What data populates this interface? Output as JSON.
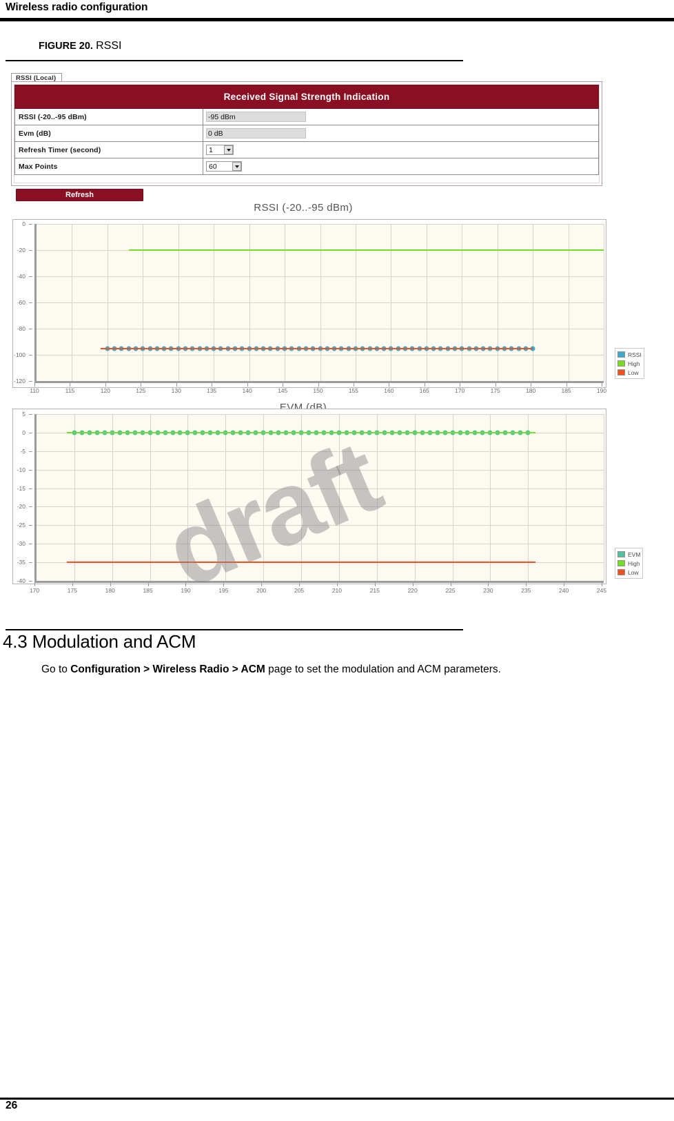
{
  "header": {
    "running_title": "Wireless radio configuration"
  },
  "figure": {
    "number": "FIGURE 20.",
    "title": "RSSI"
  },
  "ui_panel": {
    "tab_label": "RSSI (Local)",
    "panel_title": "Received Signal Strength Indication",
    "rows": [
      {
        "label": "RSSI (-20..-95 dBm)",
        "value": "-95 dBm",
        "control": "readonly"
      },
      {
        "label": "Evm (dB)",
        "value": "0 dB",
        "control": "readonly"
      },
      {
        "label": "Refresh Timer (second)",
        "value": "1",
        "control": "select"
      },
      {
        "label": "Max Points",
        "value": "60",
        "control": "select-wide"
      }
    ],
    "refresh_button": "Refresh",
    "title_bg": "#8a0f22"
  },
  "chart_data": [
    {
      "id": "rssi",
      "type": "line",
      "title": "RSSI (-20..-95 dBm)",
      "xlabel": "",
      "ylabel": "",
      "xlim": [
        110,
        190
      ],
      "ylim": [
        -120,
        0
      ],
      "xticks": [
        110,
        115,
        120,
        125,
        130,
        135,
        140,
        145,
        150,
        155,
        160,
        165,
        170,
        175,
        180,
        185,
        190
      ],
      "yticks": [
        0,
        -20,
        -40,
        -60,
        -80,
        -100,
        -120
      ],
      "grid": true,
      "legend_position": "right",
      "series": [
        {
          "name": "RSSI",
          "color": "#3fa9c9",
          "marker": "circle",
          "x": [
            120,
            121,
            122,
            123,
            124,
            125,
            126,
            127,
            128,
            129,
            130,
            131,
            132,
            133,
            134,
            135,
            136,
            137,
            138,
            139,
            140,
            141,
            142,
            143,
            144,
            145,
            146,
            147,
            148,
            149,
            150,
            151,
            152,
            153,
            154,
            155,
            156,
            157,
            158,
            159,
            160,
            161,
            162,
            163,
            164,
            165,
            166,
            167,
            168,
            169,
            170,
            171,
            172,
            173,
            174,
            175,
            176,
            177,
            178,
            179,
            180
          ],
          "values": [
            -95,
            -95,
            -95,
            -95,
            -95,
            -95,
            -95,
            -95,
            -95,
            -95,
            -95,
            -95,
            -95,
            -95,
            -95,
            -95,
            -95,
            -95,
            -95,
            -95,
            -95,
            -95,
            -95,
            -95,
            -95,
            -95,
            -95,
            -95,
            -95,
            -95,
            -95,
            -95,
            -95,
            -95,
            -95,
            -95,
            -95,
            -95,
            -95,
            -95,
            -95,
            -95,
            -95,
            -95,
            -95,
            -95,
            -95,
            -95,
            -95,
            -95,
            -95,
            -95,
            -95,
            -95,
            -95,
            -95,
            -95,
            -95,
            -95,
            -95,
            -95
          ]
        },
        {
          "name": "High",
          "color": "#77dd22",
          "marker": "line",
          "x": [
            123,
            190
          ],
          "values": [
            -20,
            -20
          ]
        },
        {
          "name": "Low",
          "color": "#f4501e",
          "marker": "line",
          "x": [
            119,
            180
          ],
          "values": [
            -95,
            -95
          ]
        }
      ],
      "legend": [
        {
          "label": "RSSI",
          "color": "#3fa9c9"
        },
        {
          "label": "High",
          "color": "#77dd22"
        },
        {
          "label": "Low",
          "color": "#f4501e"
        }
      ]
    },
    {
      "id": "evm",
      "type": "line",
      "title": "EVM (dB)",
      "xlabel": "",
      "ylabel": "",
      "xlim": [
        170,
        245
      ],
      "ylim": [
        -40,
        5
      ],
      "xticks": [
        170,
        175,
        180,
        185,
        190,
        195,
        200,
        205,
        210,
        215,
        220,
        225,
        230,
        235,
        240,
        245
      ],
      "yticks": [
        5,
        0,
        -5,
        -10,
        -15,
        -20,
        -25,
        -30,
        -35,
        -40
      ],
      "grid": true,
      "legend_position": "right",
      "series": [
        {
          "name": "EVM",
          "color": "#4fc3a1",
          "marker": "circle",
          "x": [
            175,
            176,
            177,
            178,
            179,
            180,
            181,
            182,
            183,
            184,
            185,
            186,
            187,
            188,
            189,
            190,
            191,
            192,
            193,
            194,
            195,
            196,
            197,
            198,
            199,
            200,
            201,
            202,
            203,
            204,
            205,
            206,
            207,
            208,
            209,
            210,
            211,
            212,
            213,
            214,
            215,
            216,
            217,
            218,
            219,
            220,
            221,
            222,
            223,
            224,
            225,
            226,
            227,
            228,
            229,
            230,
            231,
            232,
            233,
            234,
            235
          ],
          "values": [
            0,
            0,
            0,
            0,
            0,
            0,
            0,
            0,
            0,
            0,
            0,
            0,
            0,
            0,
            0,
            0,
            0,
            0,
            0,
            0,
            0,
            0,
            0,
            0,
            0,
            0,
            0,
            0,
            0,
            0,
            0,
            0,
            0,
            0,
            0,
            0,
            0,
            0,
            0,
            0,
            0,
            0,
            0,
            0,
            0,
            0,
            0,
            0,
            0,
            0,
            0,
            0,
            0,
            0,
            0,
            0,
            0,
            0,
            0,
            0,
            0
          ]
        },
        {
          "name": "High",
          "color": "#77dd22",
          "marker": "line",
          "x": [
            174,
            236
          ],
          "values": [
            0,
            0
          ]
        },
        {
          "name": "Low",
          "color": "#f4501e",
          "marker": "line",
          "x": [
            174,
            236
          ],
          "values": [
            -35,
            -35
          ]
        }
      ],
      "legend": [
        {
          "label": "EVM",
          "color": "#4fc3a1"
        },
        {
          "label": "High",
          "color": "#77dd22"
        },
        {
          "label": "Low",
          "color": "#f4501e"
        }
      ]
    }
  ],
  "watermark": {
    "text": "draft"
  },
  "section": {
    "heading": "4.3 Modulation and ACM",
    "body_prefix": "Go to ",
    "body_path": "Configuration > Wireless Radio > ACM",
    "body_suffix": " page to set the modulation and ACM parameters."
  },
  "footer": {
    "page_number": "26"
  }
}
